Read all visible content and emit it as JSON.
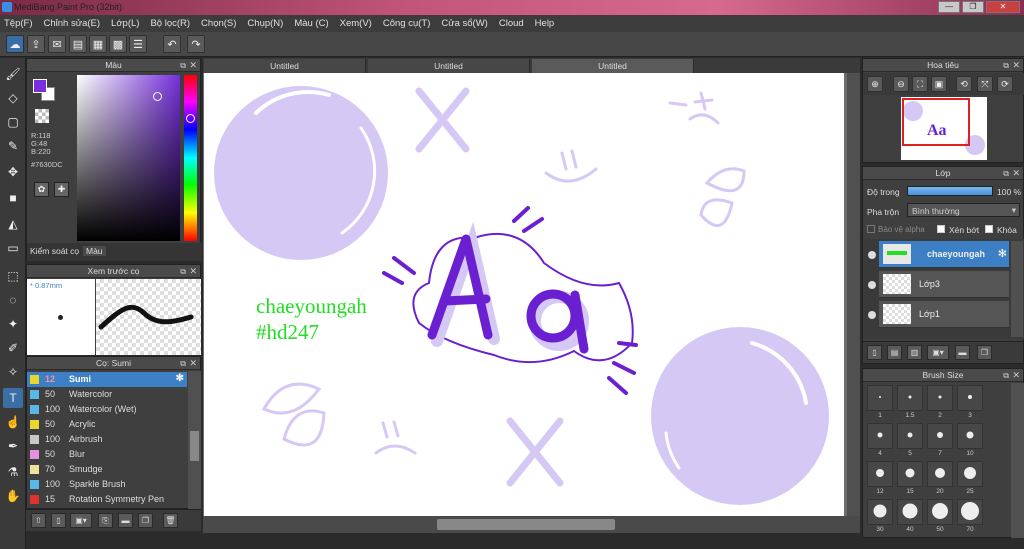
{
  "window": {
    "title": "MediBang Paint Pro (32bit)",
    "min": "—",
    "max": "❐",
    "close": "✕"
  },
  "menu": [
    "Tệp(F)",
    "Chỉnh sửa(E)",
    "Lớp(L)",
    "Bộ lọc(R)",
    "Chọn(S)",
    "Chụp(N)",
    "Màu (C)",
    "Xem(V)",
    "Công cụ(T)",
    "Cửa sổ(W)",
    "Cloud",
    "Help"
  ],
  "color_panel": {
    "title": "Màu",
    "rgb": {
      "r": "R:118",
      "g": "G:48",
      "b": "B:220"
    },
    "hex": "#7630DC",
    "primary": "#7630dc",
    "tabs": [
      "Kiểm soát cọ",
      "Màu"
    ]
  },
  "preview_panel": {
    "title": "Xem trước cọ",
    "size": "* 0.87mm"
  },
  "brush_panel": {
    "title": "Cọ: Sumi",
    "brushes": [
      {
        "size": "12",
        "name": "Sumi",
        "color": "#e6d830"
      },
      {
        "size": "50",
        "name": "Watercolor",
        "color": "#5ab8e8"
      },
      {
        "size": "100",
        "name": "Watercolor (Wet)",
        "color": "#5ab8e8"
      },
      {
        "size": "50",
        "name": "Acrylic",
        "color": "#e6d830"
      },
      {
        "size": "100",
        "name": "Airbrush",
        "color": "#c8c8c8"
      },
      {
        "size": "50",
        "name": "Blur",
        "color": "#e890e0"
      },
      {
        "size": "70",
        "name": "Smudge",
        "color": "#f0e0a0"
      },
      {
        "size": "100",
        "name": "Sparkle Brush",
        "color": "#5ab8e8"
      },
      {
        "size": "15",
        "name": "Rotation Symmetry Pen",
        "color": "#e03030"
      }
    ]
  },
  "canvas": {
    "tabs": [
      "Untitled",
      "Untitled",
      "Untitled"
    ],
    "text_line1": "chaeyoungah",
    "text_line2": "#hd247",
    "lettering": "Aa"
  },
  "navigator": {
    "title": "Hoa tiêu"
  },
  "layer_panel": {
    "title": "Lớp",
    "opacity_label": "Độ trong",
    "opacity_value": "100 %",
    "opacity_fraction": 1.0,
    "blend_label": "Pha trộn",
    "blend_value": "Bình thường",
    "protect_alpha": "Bảo vệ alpha",
    "clipping": "Xén bớt",
    "lock": "Khóa",
    "layers": [
      "chaeyoungah",
      "Lớp3",
      "Lớp1"
    ]
  },
  "brush_size_panel": {
    "title": "Brush Size",
    "sizes": [
      "1",
      "1.5",
      "2",
      "3",
      "4",
      "5",
      "7",
      "10",
      "12",
      "15",
      "20",
      "25",
      "30",
      "40",
      "50",
      "70"
    ]
  }
}
